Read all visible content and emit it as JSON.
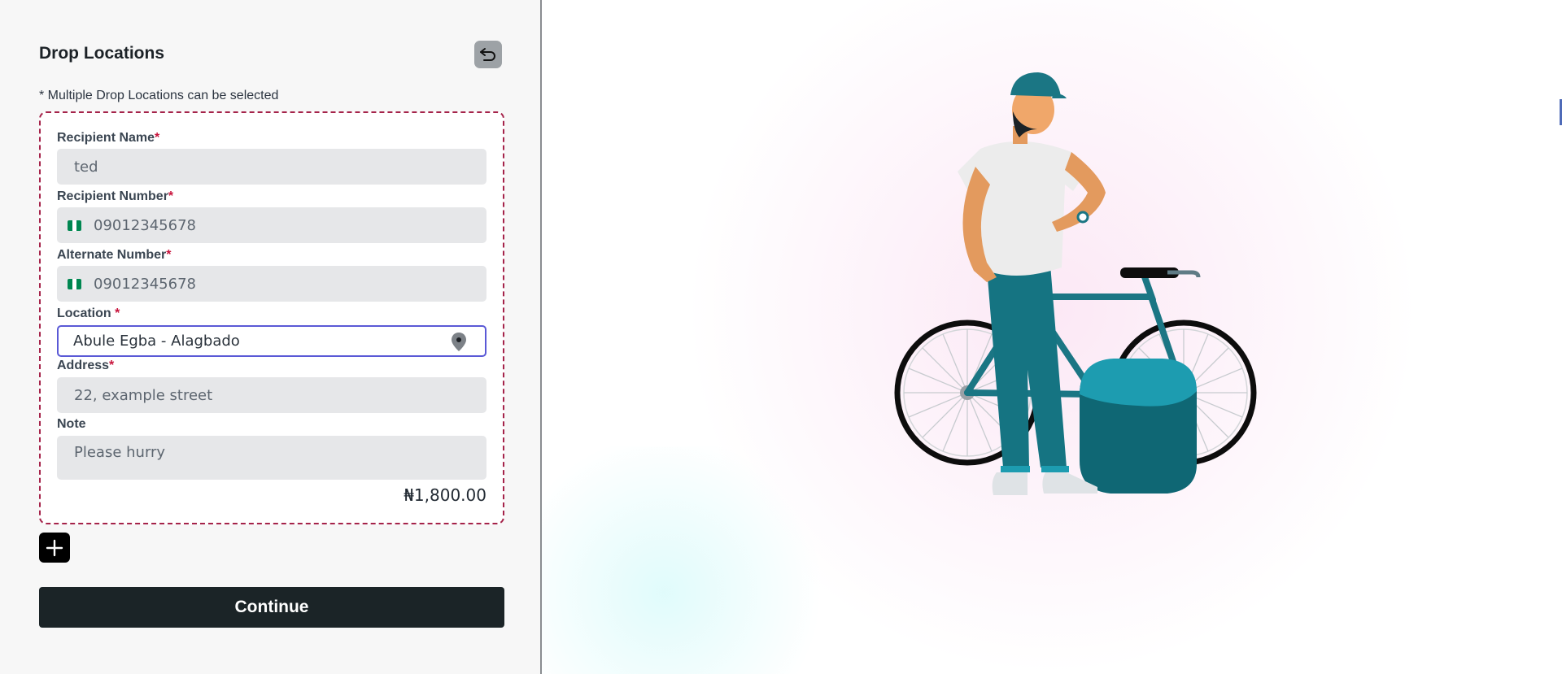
{
  "form": {
    "title": "Drop Locations",
    "hint": "* Multiple Drop Locations can be selected",
    "recipient_name": {
      "label": "Recipient Name",
      "required_mark": "*",
      "value": "ted"
    },
    "recipient_number": {
      "label": "Recipient Number",
      "required_mark": "*",
      "value": "09012345678"
    },
    "alternate_number": {
      "label": "Alternate Number",
      "required_mark": "*",
      "value": "09012345678"
    },
    "location": {
      "label": "Location ",
      "required_mark": "*",
      "value": "Abule Egba - Alagbado"
    },
    "address": {
      "label": "Address",
      "required_mark": "*",
      "value": "22, example street"
    },
    "note": {
      "label": "Note",
      "value": "Please hurry"
    },
    "price": "₦1,800.00",
    "continue_label": "Continue"
  },
  "icons": {
    "back": "undo-arrow-icon",
    "flag": "nigeria-flag-icon",
    "pin": "map-pin-icon",
    "add": "plus-icon"
  },
  "colors": {
    "accent_focus": "#5a59d6",
    "required": "#c8143c",
    "dashed_border": "#a5234a",
    "primary_button": "#1b2427",
    "flag_green": "#008751"
  }
}
